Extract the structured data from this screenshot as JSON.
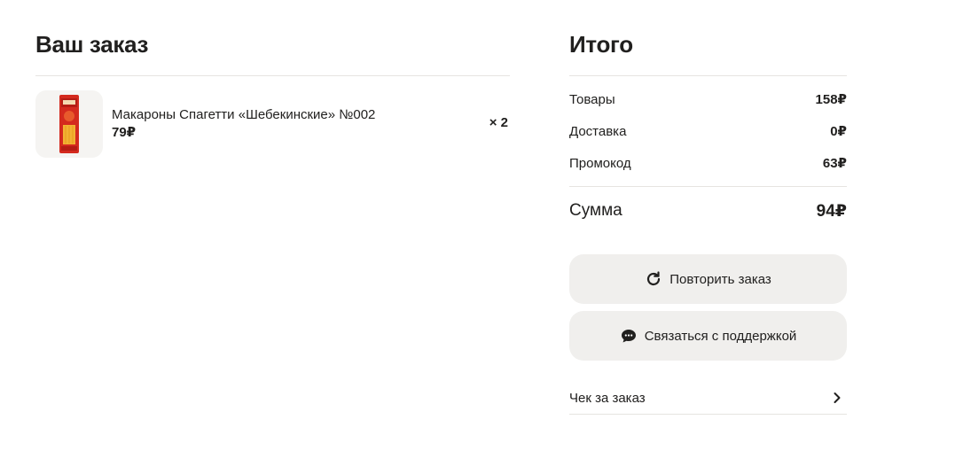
{
  "order": {
    "title": "Ваш заказ",
    "items": [
      {
        "name": "Макароны Спагетти «Шебекинские» №002",
        "price": "79₽",
        "quantity": "× 2",
        "image_icon": "pasta-package-icon"
      }
    ]
  },
  "summary": {
    "title": "Итого",
    "rows": [
      {
        "label": "Товары",
        "value": "158₽"
      },
      {
        "label": "Доставка",
        "value": "0₽"
      },
      {
        "label": "Промокод",
        "value": "63₽"
      }
    ],
    "total": {
      "label": "Сумма",
      "value": "94₽"
    }
  },
  "actions": {
    "repeat_label": "Повторить заказ",
    "repeat_icon": "refresh-icon",
    "support_label": "Связаться с поддержкой",
    "support_icon": "chat-bubble-icon",
    "receipt_label": "Чек за заказ",
    "receipt_icon": "chevron-right-icon"
  },
  "colors": {
    "text": "#21201f",
    "button_bg": "#f0efed",
    "thumb_bg": "#f5f4f2",
    "divider": "#e6e4e1",
    "package_red": "#d42a1e",
    "package_yellow": "#f2b233"
  }
}
